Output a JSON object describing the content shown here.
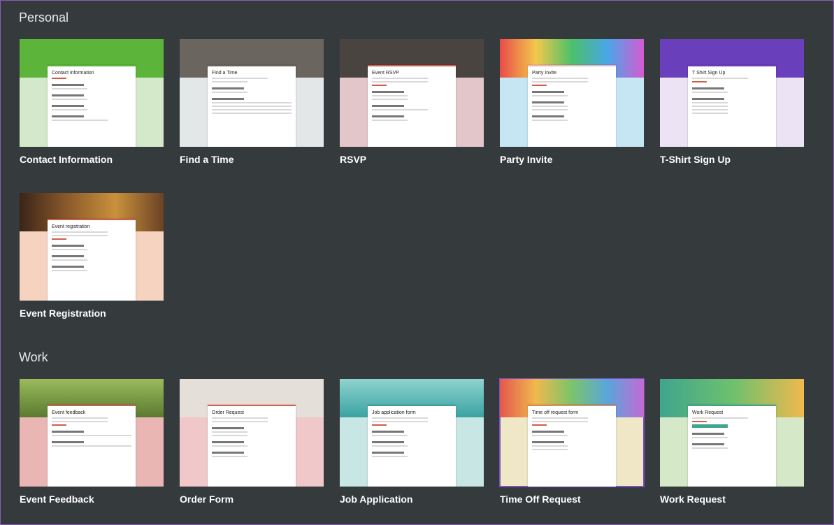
{
  "sections": {
    "personal": {
      "title": "Personal"
    },
    "work": {
      "title": "Work"
    }
  },
  "templates": {
    "contact_information": {
      "label": "Contact Information",
      "form_title": "Contact information",
      "color": "#5cb53a",
      "bg": "#d4e9c9"
    },
    "find_a_time": {
      "label": "Find a Time",
      "form_title": "Find a Time",
      "color": "#6b6560",
      "bg": "#e3e7e8"
    },
    "rsvp": {
      "label": "RSVP",
      "form_title": "Event RSVP",
      "color": "#4a4440",
      "bg": "#e3c6c9"
    },
    "party_invite": {
      "label": "Party Invite",
      "form_title": "Party Invite",
      "color": "#e8c2cc",
      "bg": "#c6e6f4"
    },
    "tshirt_sign_up": {
      "label": "T-Shirt Sign Up",
      "form_title": "T Shirt Sign Up",
      "color": "#6a3fbb",
      "bg": "#ece4f4"
    },
    "event_registration": {
      "label": "Event Registration",
      "form_title": "Event registration",
      "color": "#4a2e20",
      "bg": "#f6d2c0"
    },
    "event_feedback": {
      "label": "Event Feedback",
      "form_title": "Event feedback",
      "color": "#5b7a30",
      "bg": "#e9b6b4"
    },
    "order_form": {
      "label": "Order Form",
      "form_title": "Order Request",
      "color": "#e4dfd8",
      "bg": "#f0c8c9"
    },
    "job_application": {
      "label": "Job Application",
      "form_title": "Job application form",
      "color": "#3aa3a2",
      "bg": "#c8e6e3"
    },
    "time_off_request": {
      "label": "Time Off Request",
      "form_title": "Time off request form",
      "color": "#e08a56",
      "bg": "#efe7c6"
    },
    "work_request": {
      "label": "Work Request",
      "form_title": "Work Request",
      "color": "#3fa58e",
      "bg": "#d5e8c8"
    }
  }
}
